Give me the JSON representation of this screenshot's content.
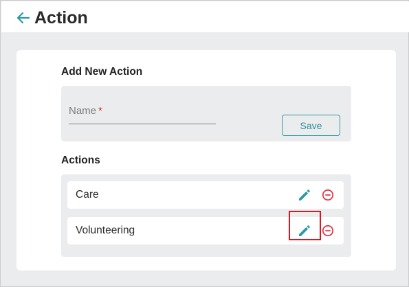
{
  "header": {
    "back_icon": "arrow-left-icon",
    "title": "Action"
  },
  "add_section": {
    "title": "Add New Action",
    "name_field": {
      "label": "Name",
      "required_marker": "*",
      "value": ""
    },
    "save_label": "Save"
  },
  "actions_section": {
    "title": "Actions",
    "items": [
      {
        "label": "Care",
        "edit_icon": "pencil-icon",
        "remove_icon": "minus-circle-icon"
      },
      {
        "label": "Volunteering",
        "edit_icon": "pencil-icon",
        "remove_icon": "minus-circle-icon"
      }
    ]
  },
  "colors": {
    "accent": "#2b9aa3",
    "danger": "#e0394a",
    "page_bg": "#ebeced",
    "highlight_box": "#e0141e"
  }
}
